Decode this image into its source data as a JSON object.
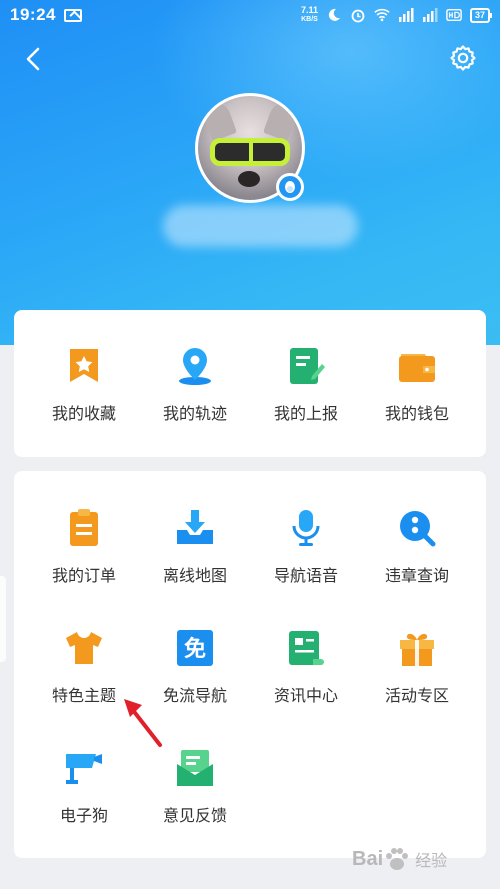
{
  "status_bar": {
    "time": "19:24",
    "net_speed_value": "7.11",
    "net_speed_unit": "KB/S",
    "battery": "37"
  },
  "header": {
    "back_icon": "chevron-left-icon",
    "settings_icon": "gear-icon"
  },
  "colors": {
    "header_gradient_start": "#1f8ff5",
    "header_gradient_end": "#3bbdf3",
    "card_background": "#ffffff",
    "page_background": "#eeeff2",
    "arrow_annotation": "#e0202a"
  },
  "quick_links": [
    {
      "label": "我的收藏",
      "icon": "star-bookmark-icon"
    },
    {
      "label": "我的轨迹",
      "icon": "location-pin-icon"
    },
    {
      "label": "我的上报",
      "icon": "report-edit-icon"
    },
    {
      "label": "我的钱包",
      "icon": "wallet-icon"
    }
  ],
  "services": [
    {
      "label": "我的订单",
      "icon": "order-clipboard-icon"
    },
    {
      "label": "离线地图",
      "icon": "download-tray-icon"
    },
    {
      "label": "导航语音",
      "icon": "microphone-icon"
    },
    {
      "label": "违章查询",
      "icon": "violation-search-icon"
    },
    {
      "label": "特色主题",
      "icon": "tshirt-theme-icon"
    },
    {
      "label": "免流导航",
      "icon": "free-data-icon",
      "glyph": "免"
    },
    {
      "label": "资讯中心",
      "icon": "news-scroll-icon"
    },
    {
      "label": "活动专区",
      "icon": "gift-icon"
    },
    {
      "label": "电子狗",
      "icon": "speed-camera-icon"
    },
    {
      "label": "意见反馈",
      "icon": "feedback-mail-icon"
    }
  ],
  "watermark": {
    "text": "Bai",
    "sub": "经验"
  }
}
